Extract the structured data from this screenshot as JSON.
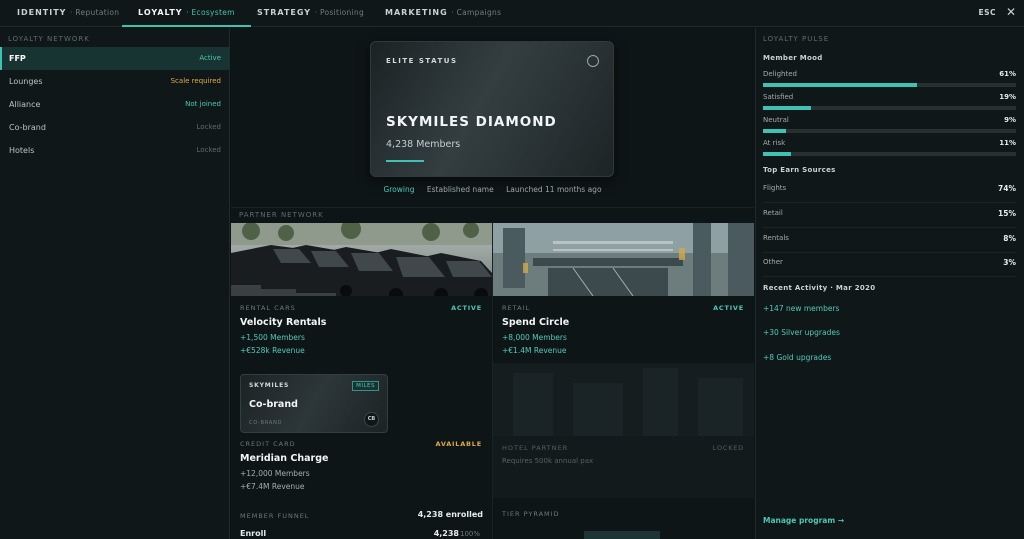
{
  "nav": {
    "tabs": [
      {
        "label": "IDENTITY",
        "sub": "· Reputation"
      },
      {
        "label": "LOYALTY",
        "sub": "· Ecosystem"
      },
      {
        "label": "STRATEGY",
        "sub": "· Positioning"
      },
      {
        "label": "MARKETING",
        "sub": "· Campaigns"
      }
    ],
    "active_tab": "LOYALTY",
    "esc_label": "ESC",
    "close_icon": "close-icon",
    "accent": "#3fc2b2"
  },
  "left": {
    "section_label": "LOYALTY NETWORK",
    "items": [
      {
        "name": "FFP",
        "status": "Active",
        "color": "#4cc7b6",
        "selected": true
      },
      {
        "name": "Lounges",
        "status": "Scale required",
        "color": "#e0a94a"
      },
      {
        "name": "Alliance",
        "status": "Not joined",
        "color": "#4cc7b6"
      },
      {
        "name": "Co-brand",
        "status": "Locked",
        "color": "#5e6c6d"
      },
      {
        "name": "Hotels",
        "status": "Locked",
        "color": "#5e6c6d"
      }
    ]
  },
  "elite": {
    "label": "ELITE STATUS",
    "title": "SKYMILES DIAMOND",
    "members": "4,238 Members",
    "tags": [
      "Growing",
      "Established name",
      "Launched 11 months ago"
    ]
  },
  "partner_network": {
    "label": "PARTNER NETWORK",
    "rental": {
      "category": "RENTAL CARS",
      "state": "ACTIVE",
      "name": "Velocity Rentals",
      "line1": "+1,500 Members",
      "line2": "+€528k Revenue"
    },
    "retail": {
      "category": "RETAIL",
      "state": "ACTIVE",
      "name": "Spend Circle",
      "line1": "+8,000 Members",
      "line2": "+€1.4M Revenue"
    },
    "cobrand_card": {
      "brand": "SKYMILES",
      "badge": "MILES",
      "title": "Co-brand",
      "sub": "CO-BRAND",
      "chip": "CB"
    },
    "credit": {
      "category": "CREDIT CARD",
      "state": "AVAILABLE",
      "name": "Meridian Charge",
      "line1": "+12,000 Members",
      "line2": "+€7.4M Revenue"
    },
    "hotel": {
      "category": "HOTEL PARTNER",
      "state": "LOCKED",
      "requirement": "Requires 500k annual pax"
    }
  },
  "funnel": {
    "label": "MEMBER FUNNEL",
    "total": "4,238 enrolled",
    "row": {
      "name": "Enroll",
      "value": "4,238",
      "pct": "100%"
    }
  },
  "tier": {
    "label": "TIER PYRAMID"
  },
  "pulse": {
    "section_label": "LOYALTY PULSE",
    "mood_title": "Member Mood",
    "mood": [
      {
        "name": "Delighted",
        "pct": "61%",
        "value": 0.61
      },
      {
        "name": "Satisfied",
        "pct": "19%",
        "value": 0.19
      },
      {
        "name": "Neutral",
        "pct": "9%",
        "value": 0.09
      },
      {
        "name": "At risk",
        "pct": "11%",
        "value": 0.11
      }
    ],
    "earn_title": "Top Earn Sources",
    "earn": [
      {
        "name": "Flights",
        "pct": "74%"
      },
      {
        "name": "Retail",
        "pct": "15%"
      },
      {
        "name": "Rentals",
        "pct": "8%"
      },
      {
        "name": "Other",
        "pct": "3%"
      }
    ],
    "activity_title": "Recent Activity · Mar 2020",
    "activity": [
      "+147 new members",
      "+30 Silver upgrades",
      "+8 Gold upgrades"
    ],
    "manage_label": "Manage program →"
  }
}
